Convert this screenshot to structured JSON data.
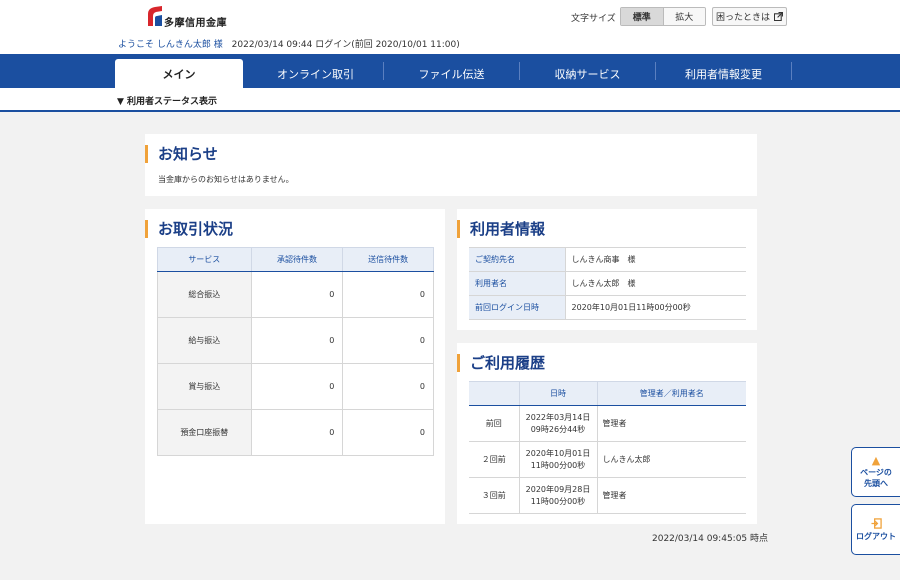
{
  "header": {
    "logo_text": "多摩信用金庫",
    "welcome_prefix": "ようこそ",
    "user_name": "しんきん太郎",
    "honorific": "様",
    "login_info": "2022/03/14 09:44 ログイン(前回 2020/10/01 11:00)",
    "font_size_label": "文字サイズ",
    "font_size_options": [
      "標準",
      "拡大"
    ],
    "font_size_selected": "標準",
    "help_label": "困ったときは",
    "help_icon": "external-link-icon"
  },
  "nav": {
    "tabs": [
      {
        "label": "メイン",
        "active": true
      },
      {
        "label": "オンライン取引",
        "active": false
      },
      {
        "label": "ファイル伝送",
        "active": false
      },
      {
        "label": "収納サービス",
        "active": false
      },
      {
        "label": "利用者情報変更",
        "active": false
      }
    ]
  },
  "status_toggle": "▼ 利用者ステータス表示",
  "notice": {
    "title": "お知らせ",
    "text": "当金庫からのお知らせはありません。"
  },
  "transactions": {
    "title": "お取引状況",
    "columns": [
      "サービス",
      "承認待件数",
      "送信待件数"
    ],
    "rows": [
      {
        "service": "総合振込",
        "approval": "0",
        "send": "0"
      },
      {
        "service": "給与振込",
        "approval": "0",
        "send": "0"
      },
      {
        "service": "賞与振込",
        "approval": "0",
        "send": "0"
      },
      {
        "service": "預金口座振替",
        "approval": "0",
        "send": "0"
      }
    ]
  },
  "user_info": {
    "title": "利用者情報",
    "rows": [
      {
        "label": "ご契約先名",
        "value": "しんきん商事　様"
      },
      {
        "label": "利用者名",
        "value": "しんきん太郎　様"
      },
      {
        "label": "前回ログイン日時",
        "value": "2020年10月01日11時00分00秒"
      }
    ]
  },
  "history": {
    "title": "ご利用履歴",
    "columns": [
      "",
      "日時",
      "管理者／利用者名"
    ],
    "rows": [
      {
        "label": "前回",
        "date1": "2022年03月14日",
        "date2": "09時26分44秒",
        "user": "管理者"
      },
      {
        "label": "２回前",
        "date1": "2020年10月01日",
        "date2": "11時00分00秒",
        "user": "しんきん太郎"
      },
      {
        "label": "３回前",
        "date1": "2020年09月28日",
        "date2": "11時00分00秒",
        "user": "管理者"
      }
    ]
  },
  "timestamp": "2022/03/14 09:45:05 時点",
  "float": {
    "page_top_label_1": "ページの",
    "page_top_label_2": "先頭へ",
    "logout_label": "ログアウト"
  },
  "colors": {
    "brand_blue": "#1b4fa0",
    "accent_orange": "#f0a23a",
    "logo_red": "#d8262c"
  }
}
